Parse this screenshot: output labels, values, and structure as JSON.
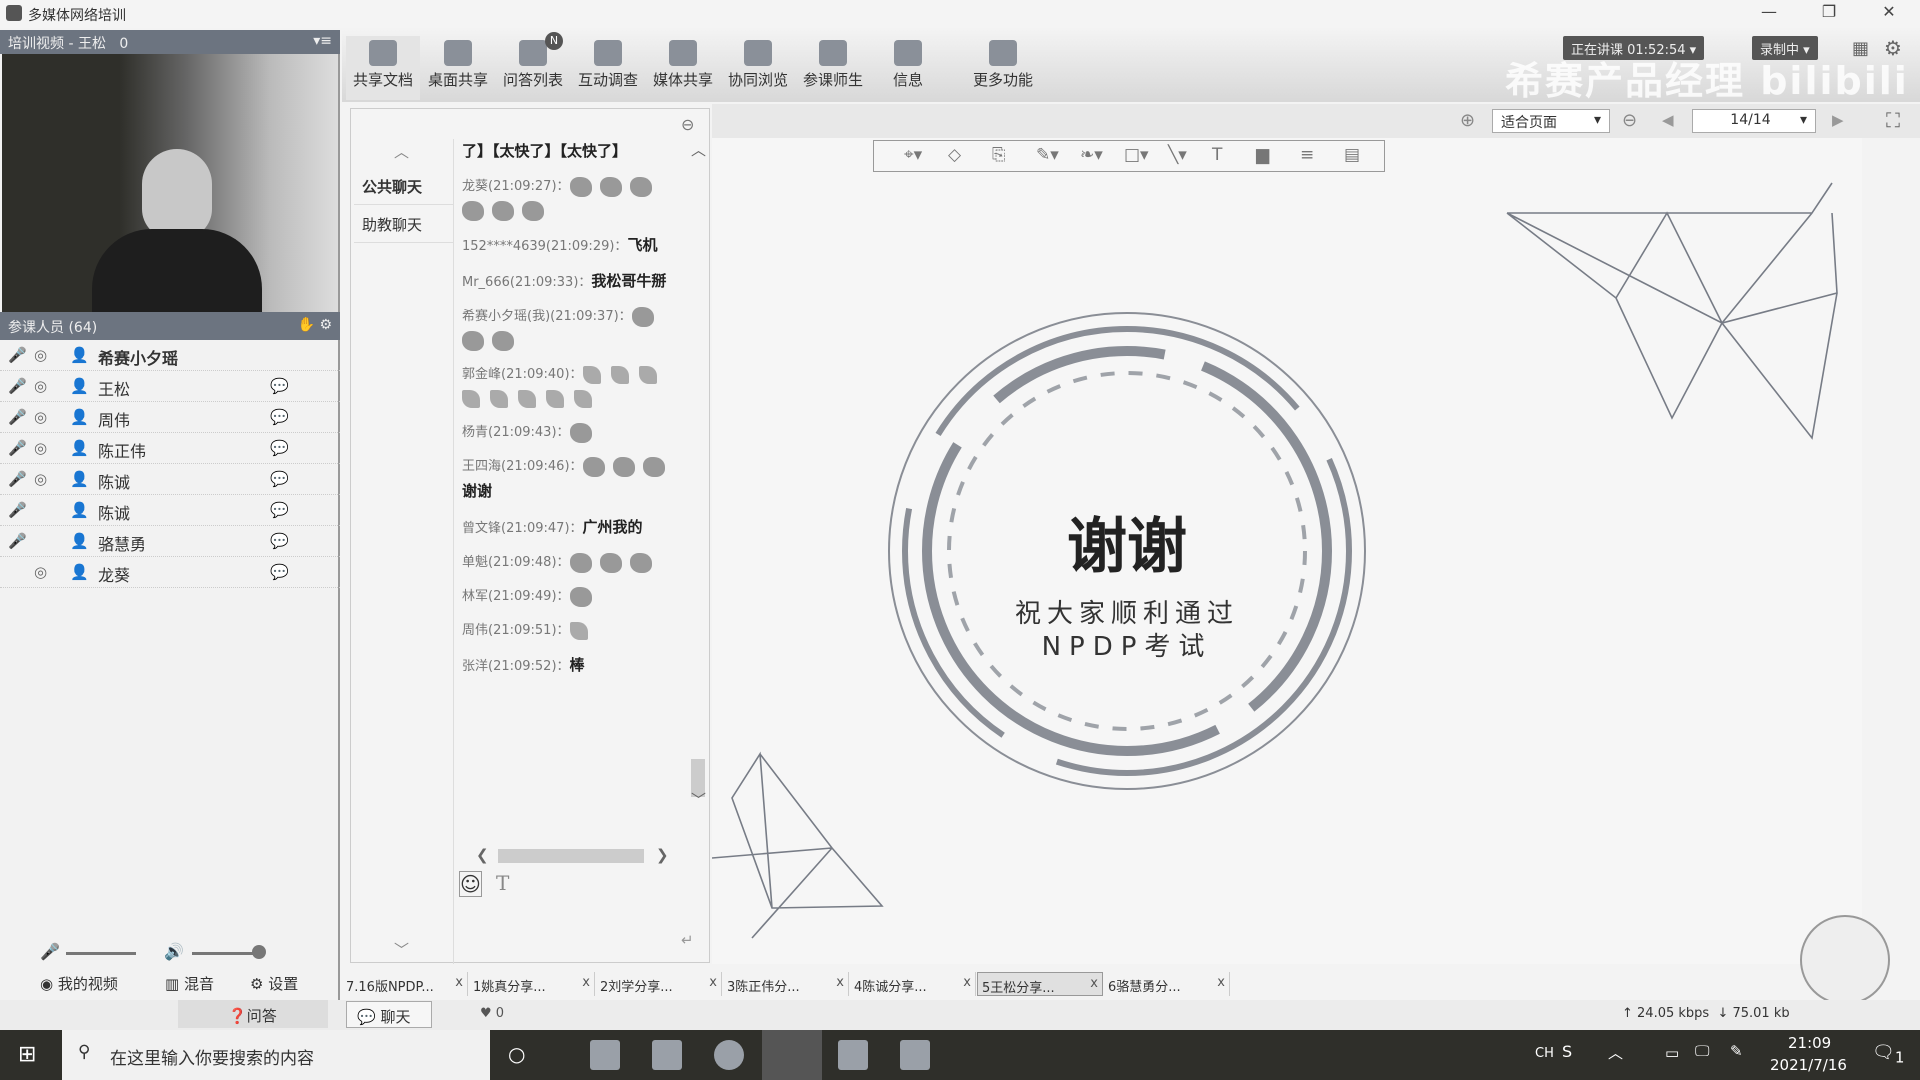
{
  "window": {
    "title": "多媒体网络培训"
  },
  "video": {
    "header": "培训视频 - 王松",
    "count": "0"
  },
  "participants": {
    "header": "参课人员 (64)",
    "list": [
      {
        "name": "希赛小夕瑶",
        "self": true
      },
      {
        "name": "王松"
      },
      {
        "name": "周伟"
      },
      {
        "name": "陈正伟"
      },
      {
        "name": "陈诚"
      },
      {
        "name": "陈诚"
      },
      {
        "name": "骆慧勇"
      },
      {
        "name": "龙葵"
      }
    ]
  },
  "toolbar": {
    "items": [
      "共享文档",
      "桌面共享",
      "问答列表",
      "互动调查",
      "媒体共享",
      "协同浏览",
      "参课师生",
      "信息",
      "更多功能"
    ],
    "badge": "N"
  },
  "header": {
    "lecture_status": "正在讲课 01:52:54",
    "recording": "录制中",
    "watermark": "希赛产品经理 bilibili"
  },
  "nav": {
    "zoom_mode": "适合页面",
    "page": "14/14"
  },
  "chat": {
    "tabs": [
      "公共聊天",
      "助教聊天"
    ],
    "messages": [
      {
        "who": "",
        "text": "了】【太快了】【太快了】"
      },
      {
        "who": "龙葵(21:09:27)：",
        "emoji": 6
      },
      {
        "who": "152****4639(21:09:29)：",
        "text": "飞机"
      },
      {
        "who": "Mr_666(21:09:33)：",
        "text": "我松哥牛掰"
      },
      {
        "who": "希赛小夕瑶(我)(21:09:37)：",
        "emoji": 3
      },
      {
        "who": "郭金峰(21:09:40)：",
        "rocket": 8
      },
      {
        "who": "杨青(21:09:43)：",
        "emoji": 1
      },
      {
        "who": "王四海(21:09:46)：",
        "emoji": 3,
        "text": "谢谢"
      },
      {
        "who": "曾文锋(21:09:47)：",
        "text": "广州我的"
      },
      {
        "who": "单魁(21:09:48)：",
        "emoji": 3
      },
      {
        "who": "林军(21:09:49)：",
        "emoji": 1
      },
      {
        "who": "周伟(21:09:51)：",
        "rocket": 1
      },
      {
        "who": "张洋(21:09:52)：",
        "text": "棒"
      }
    ]
  },
  "slide": {
    "title": "谢谢",
    "line1": "祝大家顺利通过",
    "line2": "NPDP考试"
  },
  "doc_tabs": [
    "7.16版NPDP...",
    "1姚真分享...",
    "2刘学分享...",
    "3陈正伟分...",
    "4陈诚分享...",
    "5王松分享...",
    "6骆慧勇分..."
  ],
  "active_doc_tab": 5,
  "bottom": {
    "my_video": "我的视频",
    "mix": "混音",
    "settings": "设置",
    "qa_tab": "问答",
    "chat_tab": "聊天",
    "likes": "0",
    "upload": "24.05 kbps",
    "download": "75.01 kb"
  },
  "taskbar": {
    "search_placeholder": "在这里输入你要搜索的内容",
    "ime": "CH",
    "time": "21:09",
    "date": "2021/7/16",
    "notif": "1"
  }
}
